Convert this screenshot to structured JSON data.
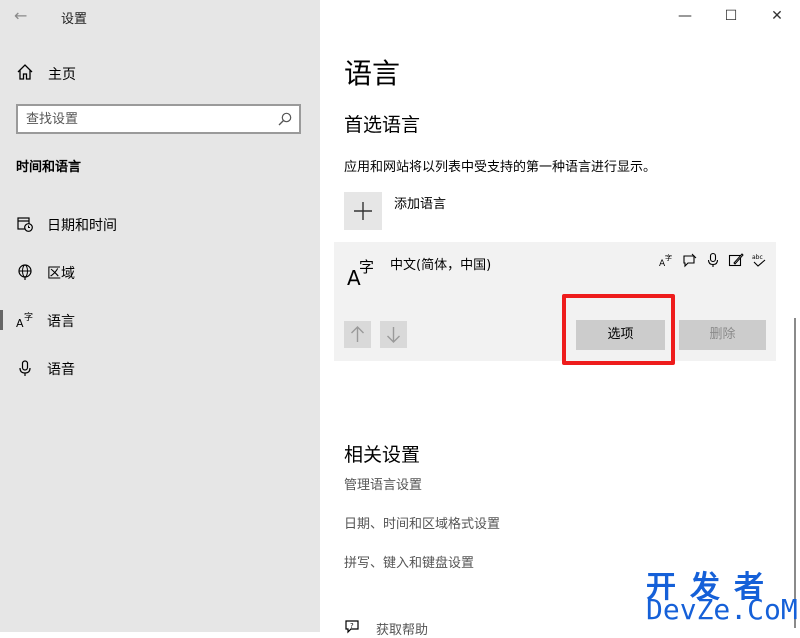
{
  "window": {
    "app_title": "设置",
    "minimize": "—",
    "maximize": "☐",
    "close": "✕"
  },
  "sidebar": {
    "home_label": "主页",
    "search_placeholder": "查找设置",
    "category": "时间和语言",
    "items": [
      {
        "label": "日期和时间",
        "icon": "calendar-clock-icon"
      },
      {
        "label": "区域",
        "icon": "globe-icon"
      },
      {
        "label": "语言",
        "icon": "language-icon",
        "selected": true
      },
      {
        "label": "语音",
        "icon": "microphone-icon"
      }
    ]
  },
  "main": {
    "title": "语言",
    "preferred_title": "首选语言",
    "description": "应用和网站将以列表中受支持的第一种语言进行显示。",
    "add_language_label": "添加语言",
    "language_card": {
      "name": "中文(简体，中国)",
      "feature_icons": [
        "display-language-icon",
        "speech-bubble-icon",
        "microphone-icon",
        "handwriting-icon",
        "spellcheck-icon"
      ],
      "options_label": "选项",
      "remove_label": "删除"
    },
    "related_title": "相关设置",
    "related_links": [
      "管理语言设置",
      "日期、时间和区域格式设置",
      "拼写、键入和键盘设置"
    ],
    "help_label": "获取帮助"
  },
  "watermark": {
    "line1": "开发者",
    "line2": "DevZe.CoM"
  },
  "colors": {
    "sidebar_bg": "#e6e6e6",
    "highlight": "#ee1c1c",
    "watermark": "#1560d8"
  }
}
